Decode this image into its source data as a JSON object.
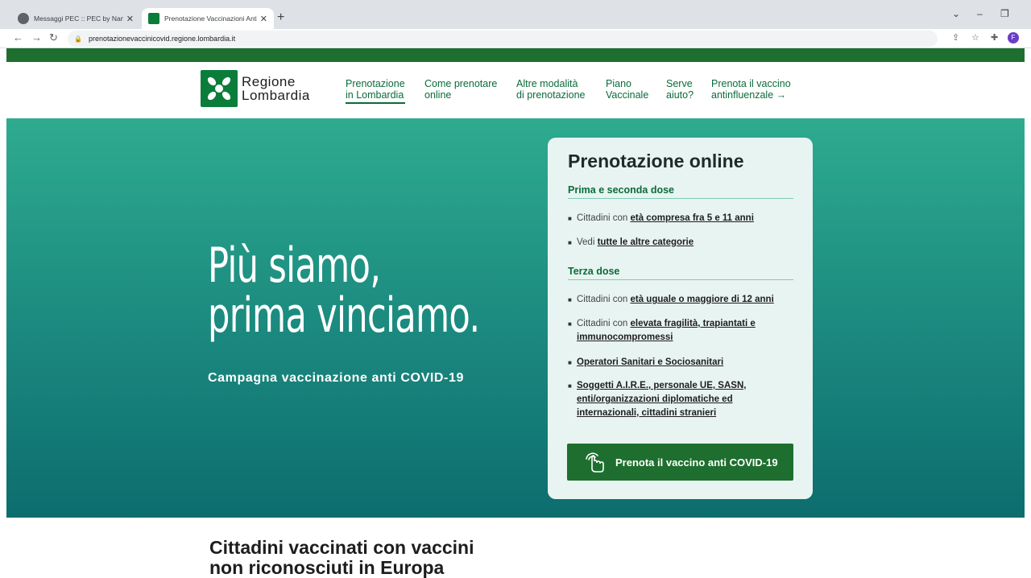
{
  "browser": {
    "tabs": [
      {
        "title": "Messaggi PEC :: PEC by Namirial",
        "favicon_color": "#5f6368"
      },
      {
        "title": "Prenotazione Vaccinazioni Anti C",
        "favicon_color": "#0a7d3a"
      }
    ],
    "url": "prenotazionevaccinicovid.regione.lombardia.it",
    "profile_initial": "F"
  },
  "site": {
    "logo": {
      "line1": "Regione",
      "line2": "Lombardia"
    },
    "nav": [
      {
        "line1": "Prenotazione",
        "line2": "in Lombardia"
      },
      {
        "line1": "Come prenotare",
        "line2": "online"
      },
      {
        "line1": "Altre modalità",
        "line2": "di prenotazione"
      },
      {
        "line1": "Piano",
        "line2": "Vaccinale"
      },
      {
        "line1": "Serve",
        "line2": "aiuto?"
      },
      {
        "line1": "Prenota il vaccino",
        "line2": "antinfluenzale →"
      }
    ],
    "hero": {
      "headline_line1": "Più siamo,",
      "headline_line2": "prima vinciamo.",
      "subtitle": "Campagna vaccinazione anti COVID-19"
    },
    "card": {
      "title": "Prenotazione online",
      "section1": "Prima e seconda dose",
      "s1_items": [
        {
          "pre": "Cittadini con ",
          "link": "età compresa fra 5 e 11 anni"
        },
        {
          "pre": "Vedi ",
          "link": "tutte le altre categorie"
        }
      ],
      "section2": "Terza dose",
      "s2_items": [
        {
          "pre": "Cittadini con ",
          "link": "età uguale o maggiore di 12 anni"
        },
        {
          "pre": "Cittadini con ",
          "link": "elevata fragilità, trapiantati e immunocompromessi"
        },
        {
          "pre": "",
          "link": "Operatori Sanitari e Sociosanitari"
        },
        {
          "pre": "",
          "link": "Soggetti A.I.R.E., personale UE, SASN, enti/organizzazioni diplomatiche ed internazionali, cittadini stranieri"
        }
      ],
      "cta_label": "Prenota il vaccino anti COVID-19"
    },
    "bottom": {
      "title_line1": "Cittadini vaccinati con vaccini",
      "title_line2": "non riconosciuti in Europa"
    },
    "colors": {
      "brand_green": "#1e6f2f",
      "teal_top": "#2eab8f",
      "teal_bottom": "#0d6d6e",
      "card_bg": "#e8f4f1"
    }
  }
}
